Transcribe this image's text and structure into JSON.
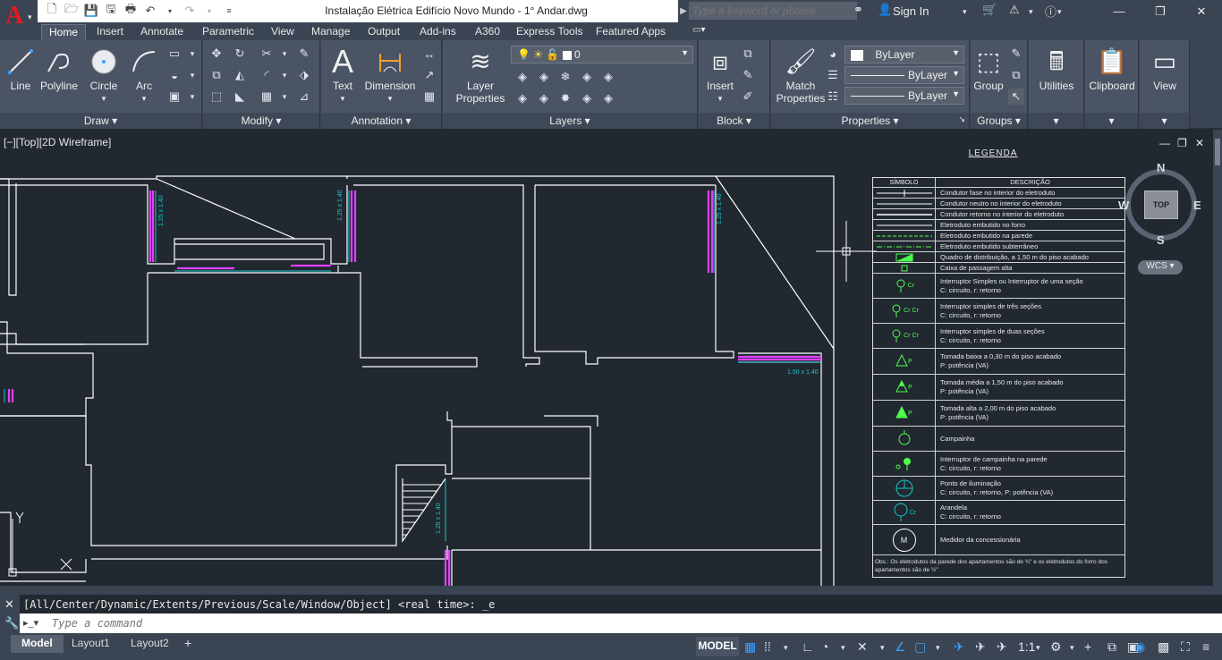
{
  "window": {
    "title": "Instalação Elétrica Edifício Novo Mundo - 1° Andar.dwg",
    "search_placeholder": "Type a keyword or phrase",
    "sign_in": "Sign In"
  },
  "ribbon_tabs": [
    "Home",
    "Insert",
    "Annotate",
    "Parametric",
    "View",
    "Manage",
    "Output",
    "Add-ins",
    "A360",
    "Express Tools",
    "Featured Apps"
  ],
  "ribbon": {
    "draw": {
      "title": "Draw",
      "line": "Line",
      "polyline": "Polyline",
      "circle": "Circle",
      "arc": "Arc"
    },
    "modify": {
      "title": "Modify"
    },
    "annotation": {
      "title": "Annotation",
      "text": "Text",
      "dimension": "Dimension"
    },
    "layers": {
      "title": "Layers",
      "layer_properties_1": "Layer",
      "layer_properties_2": "Properties",
      "current_layer": "0"
    },
    "block": {
      "title": "Block",
      "insert": "Insert"
    },
    "properties": {
      "title": "Properties",
      "match_1": "Match",
      "match_2": "Properties",
      "color": "ByLayer",
      "linetype": "ByLayer",
      "lineweight": "ByLayer"
    },
    "groups": {
      "title": "Groups",
      "group": "Group"
    },
    "utilities": "Utilities",
    "clipboard": "Clipboard",
    "view": "View"
  },
  "viewport": {
    "label": "[−][Top][2D Wireframe]",
    "viewcube": {
      "n": "N",
      "s": "S",
      "e": "E",
      "w": "W",
      "top": "TOP",
      "wcs": "WCS"
    }
  },
  "drawing": {
    "dim_labels": [
      "1.25 x 1.40",
      "1.25 x 1.40",
      "1.25 x 1.40",
      "1.50 x 1.40",
      "1.25 x 1.40"
    ]
  },
  "legend": {
    "title": "LEGENDA",
    "header_symbol": "SÍMBOLO",
    "header_description": "DESCRIÇÃO",
    "rows": [
      {
        "symbol": "",
        "line1": "Condutor fase no interior do eletroduto",
        "line2": ""
      },
      {
        "symbol": "",
        "line1": "Condutor neutro no interior do eletroduto",
        "line2": ""
      },
      {
        "symbol": "",
        "line1": "Condutor retorno no interior do eletroduto",
        "line2": ""
      },
      {
        "symbol": "",
        "line1": "Eletroduto embutido no forro",
        "line2": ""
      },
      {
        "symbol": "",
        "line1": "Eletroduto embutido na parede",
        "line2": ""
      },
      {
        "symbol": "",
        "line1": "Eletroduto embutido subterrâneo",
        "line2": ""
      },
      {
        "symbol": "",
        "line1": "Quadro de distribuição, a 1,50 m do piso acabado",
        "line2": ""
      },
      {
        "symbol": "",
        "line1": "Caixa de passagem alta",
        "line2": ""
      },
      {
        "symbol": "Cr",
        "line1": "Interruptor Simples ou Interruptor de uma seção",
        "line2": "C: circuito, r: retorno"
      },
      {
        "symbol": "Cr Cr",
        "line1": "Interruptor simples de três seções",
        "line2": "C: circuito, r: retorno"
      },
      {
        "symbol": "Cr Cr",
        "line1": "Interruptor simples de duas seções",
        "line2": "C: circuito, r: retorno"
      },
      {
        "symbol": "P",
        "line1": "Tomada baixa a 0,30 m do piso acabado",
        "line2": "P: potência (VA)"
      },
      {
        "symbol": "P",
        "line1": "Tomada média a 1,50 m do piso acabado",
        "line2": "P: potência (VA)"
      },
      {
        "symbol": "P",
        "line1": "Tomada alta a 2,00 m do piso acabado",
        "line2": "P: potência (VA)"
      },
      {
        "symbol": "",
        "line1": "Campainha",
        "line2": ""
      },
      {
        "symbol": "",
        "line1": "Interruptor de campainha na parede",
        "line2": "C: circuito, r: retorno"
      },
      {
        "symbol": "",
        "line1": "Ponto de iluminação",
        "line2": "C: circuito, r: retorno, P: potência (VA)"
      },
      {
        "symbol": "Cr",
        "line1": "Arandela",
        "line2": "C: circuito, r: retorno"
      },
      {
        "symbol": "M",
        "line1": "Medidor da concessionária",
        "line2": ""
      }
    ],
    "obs": "Obs.: Os eletrodutos da parede dos apartamentos são de ¾\" e os eletrodutos do forro dos apartamentos são de ½\""
  },
  "command": {
    "history": "[All/Center/Dynamic/Extents/Previous/Scale/Window/Object] <real time>: _e",
    "placeholder": "Type a command"
  },
  "status": {
    "layouts": [
      "Model",
      "Layout1",
      "Layout2"
    ],
    "model": "MODEL",
    "scale": "1:1"
  }
}
